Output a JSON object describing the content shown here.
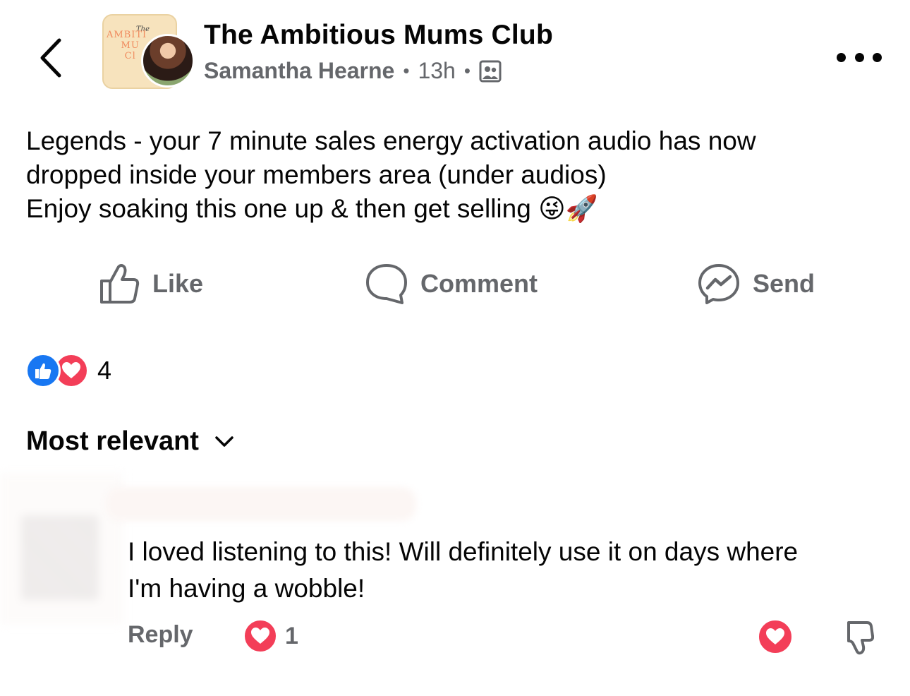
{
  "header": {
    "title": "The Ambitious Mums Club",
    "author": "Samantha Hearne",
    "time": "13h",
    "back_icon": "chevron-left-icon",
    "privacy_icon": "group-members-icon",
    "more_icon": "more-horizontal-icon",
    "group_logo_text": "The AMBITIOUS MUMS Club"
  },
  "post": {
    "lines": [
      "Legends - your 7 minute sales energy activation audio has now",
      "dropped inside your members area (under audios)",
      "Enjoy soaking this one up & then get selling 😜🚀"
    ]
  },
  "actions": {
    "like": "Like",
    "comment": "Comment",
    "send": "Send"
  },
  "reactions": {
    "count": "4",
    "types": [
      "like",
      "love"
    ]
  },
  "sort": {
    "label": "Most relevant"
  },
  "comment": {
    "lines": [
      "I loved listening to this! Will definitely use it on days where",
      "I'm having a wobble!"
    ],
    "reply_label": "Reply",
    "reaction_count": "1"
  },
  "colors": {
    "secondary_text": "#65676b",
    "like_blue": "#1877f2",
    "love_red": "#f33e58"
  }
}
